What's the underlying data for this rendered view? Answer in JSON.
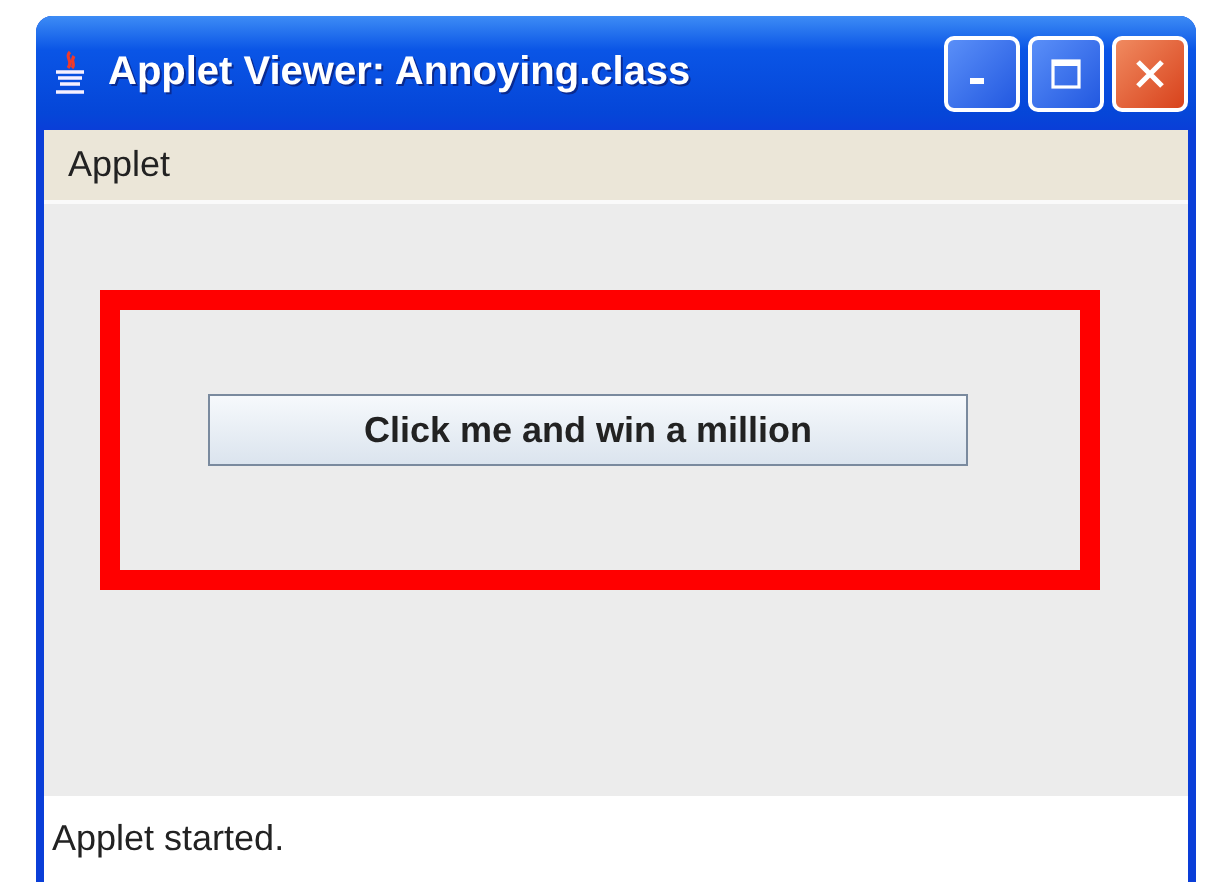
{
  "window": {
    "title": "Applet Viewer: Annoying.class"
  },
  "menu_bar": [
    "Applet"
  ],
  "button": {
    "label": "Click me and win a million"
  },
  "status_bar": "Applet started."
}
